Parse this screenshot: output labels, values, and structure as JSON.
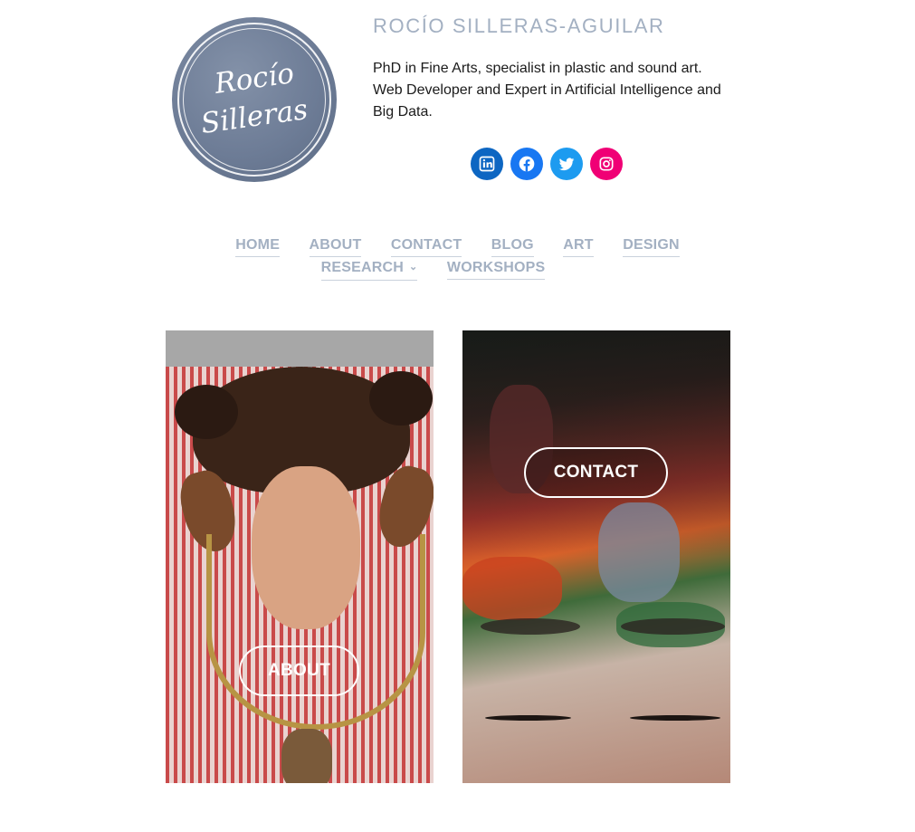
{
  "site": {
    "logo_line1": "Rocío",
    "logo_line2": "Silleras",
    "title": "ROCÍO SILLERAS-AGUILAR",
    "tagline": "PhD in Fine Arts, specialist in plastic and sound art. Web Developer and Expert in Artificial Intelligence and Big Data."
  },
  "social": [
    {
      "name": "linkedin-icon",
      "color": "#0d66c2"
    },
    {
      "name": "facebook-icon",
      "color": "#1877f2"
    },
    {
      "name": "twitter-icon",
      "color": "#1d9bf0"
    },
    {
      "name": "instagram-icon",
      "color": "#f00075"
    }
  ],
  "nav": {
    "home": "HOME",
    "about": "ABOUT",
    "contact": "CONTACT",
    "blog": "BLOG",
    "art": "ART",
    "design": "DESIGN",
    "research": "RESEARCH",
    "workshops": "WORKSHOPS"
  },
  "cards": {
    "about_label": "ABOUT",
    "contact_label": "CONTACT"
  },
  "colors": {
    "title": "#a3b0c2",
    "nav": "#a3b0c2",
    "logo": "#6d7c96"
  }
}
